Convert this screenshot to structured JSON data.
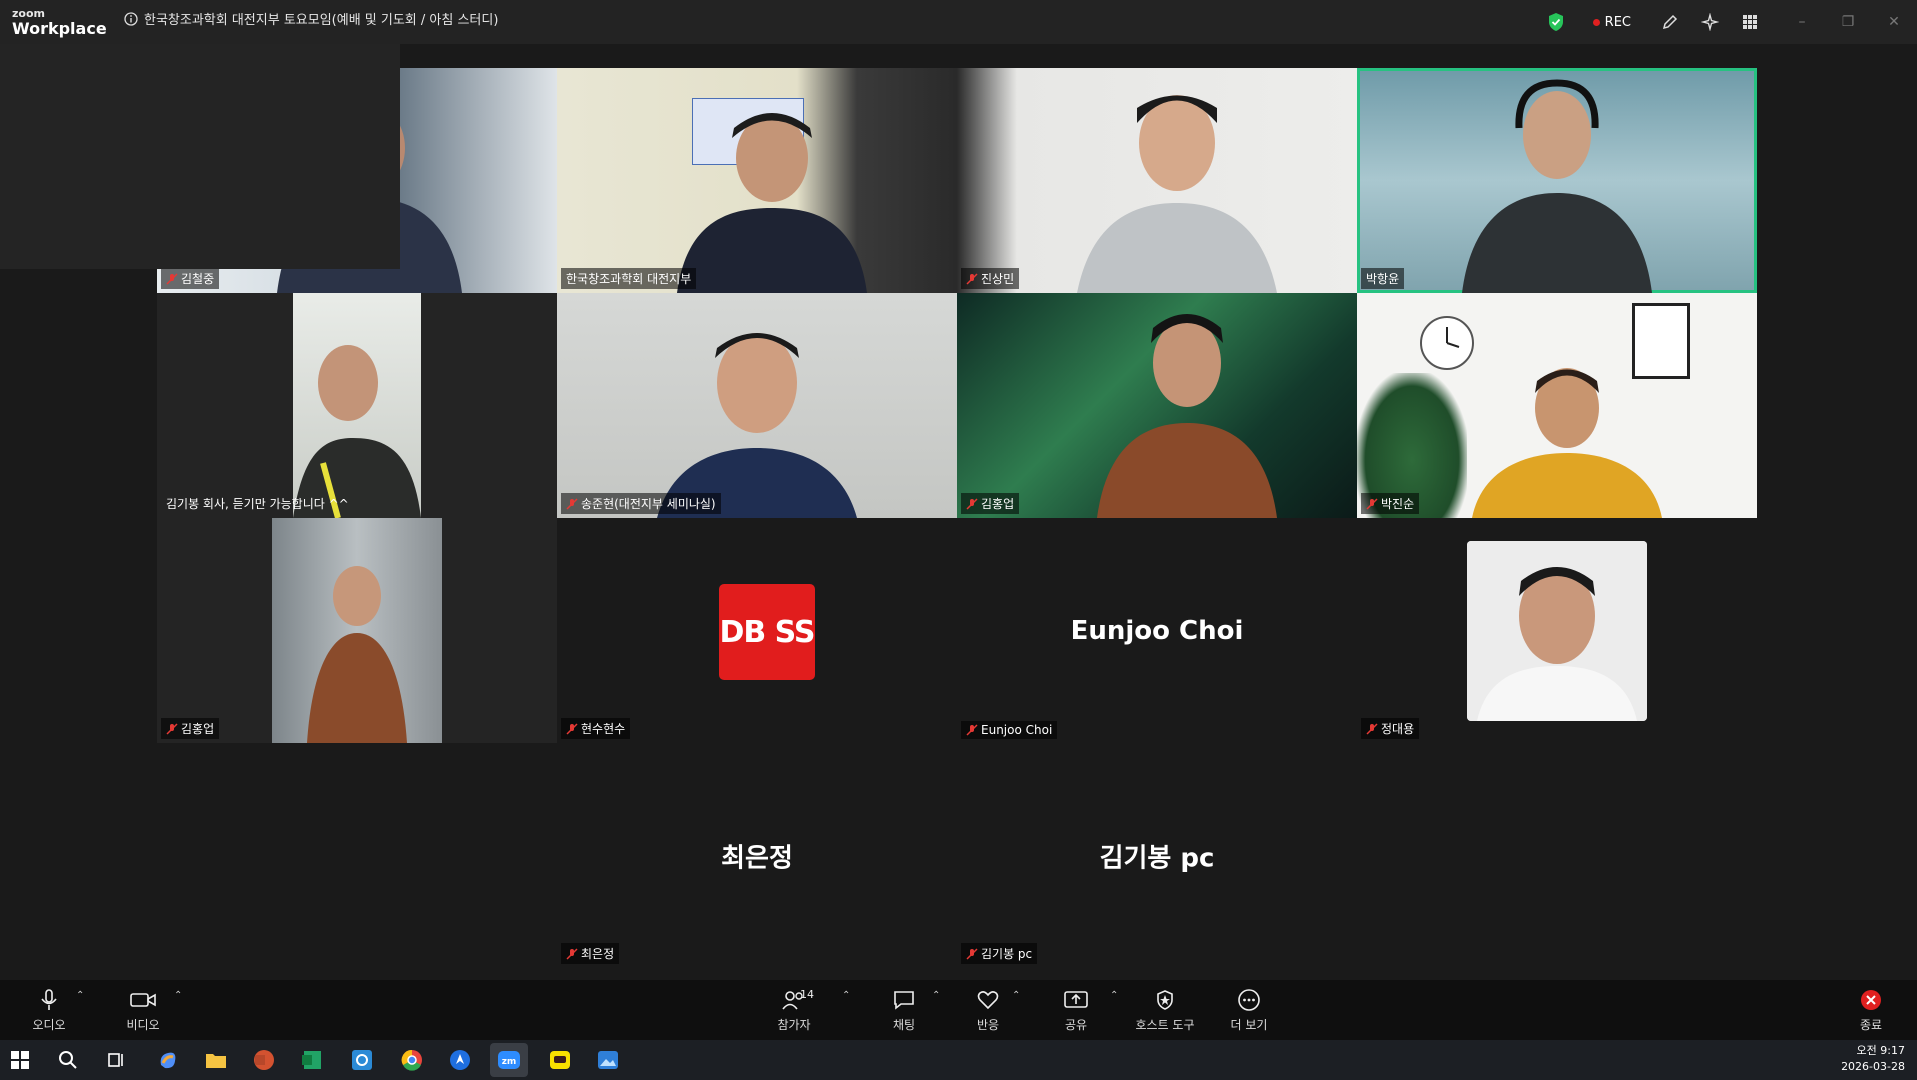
{
  "app": {
    "logo_top": "zoom",
    "logo_bottom": "Workplace"
  },
  "meeting": {
    "title": "한국창조과학회 대전지부 토요모임(예배 및 기도회 / 아침 스터디)"
  },
  "recording": {
    "label": "REC"
  },
  "participants": [
    {
      "name": "김철중",
      "muted": true
    },
    {
      "name": "한국창조과학회 대전지부",
      "muted": false
    },
    {
      "name": "진상민",
      "muted": true
    },
    {
      "name": "박항윤",
      "muted": false,
      "active_speaker": true
    },
    {
      "name": "김기봉 회사, 듣기만 가능합니다 ^^",
      "muted": false
    },
    {
      "name": "송준현(대전지부 세미나실)",
      "muted": true
    },
    {
      "name": "김홍업",
      "muted": true
    },
    {
      "name": "박진순",
      "muted": true
    },
    {
      "name": "김홍업",
      "muted": true
    },
    {
      "name": "현수현수",
      "muted": true,
      "avatar_text": "DB SS"
    },
    {
      "name": "Eunjoo Choi",
      "muted": true,
      "display_text": "Eunjoo Choi"
    },
    {
      "name": "정대용",
      "muted": true
    },
    {
      "name": "최은정",
      "muted": true,
      "display_text": "최은정"
    },
    {
      "name": "김기봉 pc",
      "muted": true,
      "display_text": "김기봉 pc"
    }
  ],
  "controls": {
    "audio": "오디오",
    "video": "비디오",
    "participants": "참가자",
    "participant_count": "14",
    "chat": "채팅",
    "reactions": "반응",
    "share": "공유",
    "host_tools": "호스트 도구",
    "more": "더 보기",
    "end": "종료"
  },
  "taskbar": {
    "time": "오전 9:17",
    "date": "2026-03-28"
  },
  "colors": {
    "active_border": "#26c281",
    "rec_dot": "#e02020",
    "end_red": "#e02020",
    "dbss_red": "#e11d1d"
  }
}
